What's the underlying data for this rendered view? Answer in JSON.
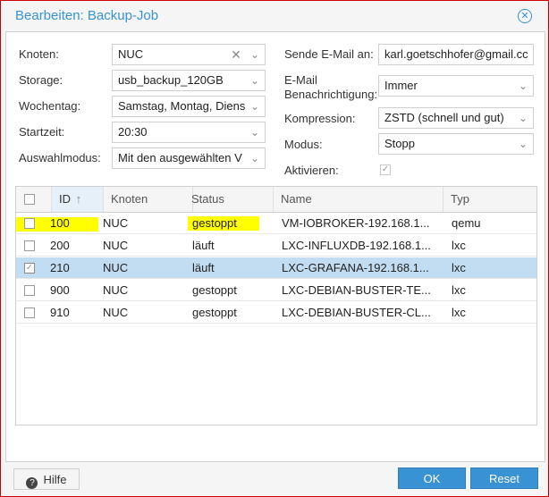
{
  "dialog": {
    "title": "Bearbeiten: Backup-Job",
    "close_icon": "close-circle-icon"
  },
  "left_form": {
    "node": {
      "label": "Knoten:",
      "value": "NUC"
    },
    "storage": {
      "label": "Storage:",
      "value": "usb_backup_120GB"
    },
    "weekday": {
      "label": "Wochentag:",
      "value": "Samstag, Montag, Diens"
    },
    "start_time": {
      "label": "Startzeit:",
      "value": "20:30"
    },
    "selection_mode": {
      "label": "Auswahlmodus:",
      "value": "Mit den ausgewählten V"
    }
  },
  "right_form": {
    "email_to": {
      "label": "Sende E-Mail an:",
      "value": "karl.goetschhofer@gmail.cc"
    },
    "email_notify": {
      "label_line1": "E-Mail",
      "label_line2": "Benachrichtigung:",
      "value": "Immer"
    },
    "compression": {
      "label": "Kompression:",
      "value": "ZSTD (schnell und gut)"
    },
    "mode": {
      "label": "Modus:",
      "value": "Stopp"
    },
    "enable": {
      "label": "Aktivieren:",
      "checked": true
    }
  },
  "grid": {
    "headers": {
      "id": "ID",
      "sort_arrow": "↑",
      "node": "Knoten",
      "status": "Status",
      "name": "Name",
      "type": "Typ"
    },
    "rows": [
      {
        "id": "100",
        "node": "NUC",
        "status": "gestoppt",
        "name": "VM-IOBROKER-192.168.1...",
        "type": "qemu",
        "checked": false,
        "selected": false
      },
      {
        "id": "200",
        "node": "NUC",
        "status": "läuft",
        "name": "LXC-INFLUXDB-192.168.1...",
        "type": "lxc",
        "checked": false,
        "selected": false
      },
      {
        "id": "210",
        "node": "NUC",
        "status": "läuft",
        "name": "LXC-GRAFANA-192.168.1...",
        "type": "lxc",
        "checked": true,
        "selected": true
      },
      {
        "id": "900",
        "node": "NUC",
        "status": "gestoppt",
        "name": "LXC-DEBIAN-BUSTER-TE...",
        "type": "lxc",
        "checked": false,
        "selected": false
      },
      {
        "id": "910",
        "node": "NUC",
        "status": "gestoppt",
        "name": "LXC-DEBIAN-BUSTER-CL...",
        "type": "lxc",
        "checked": false,
        "selected": false
      }
    ]
  },
  "footer": {
    "help_label": "Hilfe",
    "help_icon": "question-icon",
    "ok_label": "OK",
    "reset_label": "Reset"
  },
  "colors": {
    "accent": "#3892d4",
    "selected_row": "#c2ddf2",
    "highlight": "#ffff00",
    "frame": "#cc0000"
  }
}
